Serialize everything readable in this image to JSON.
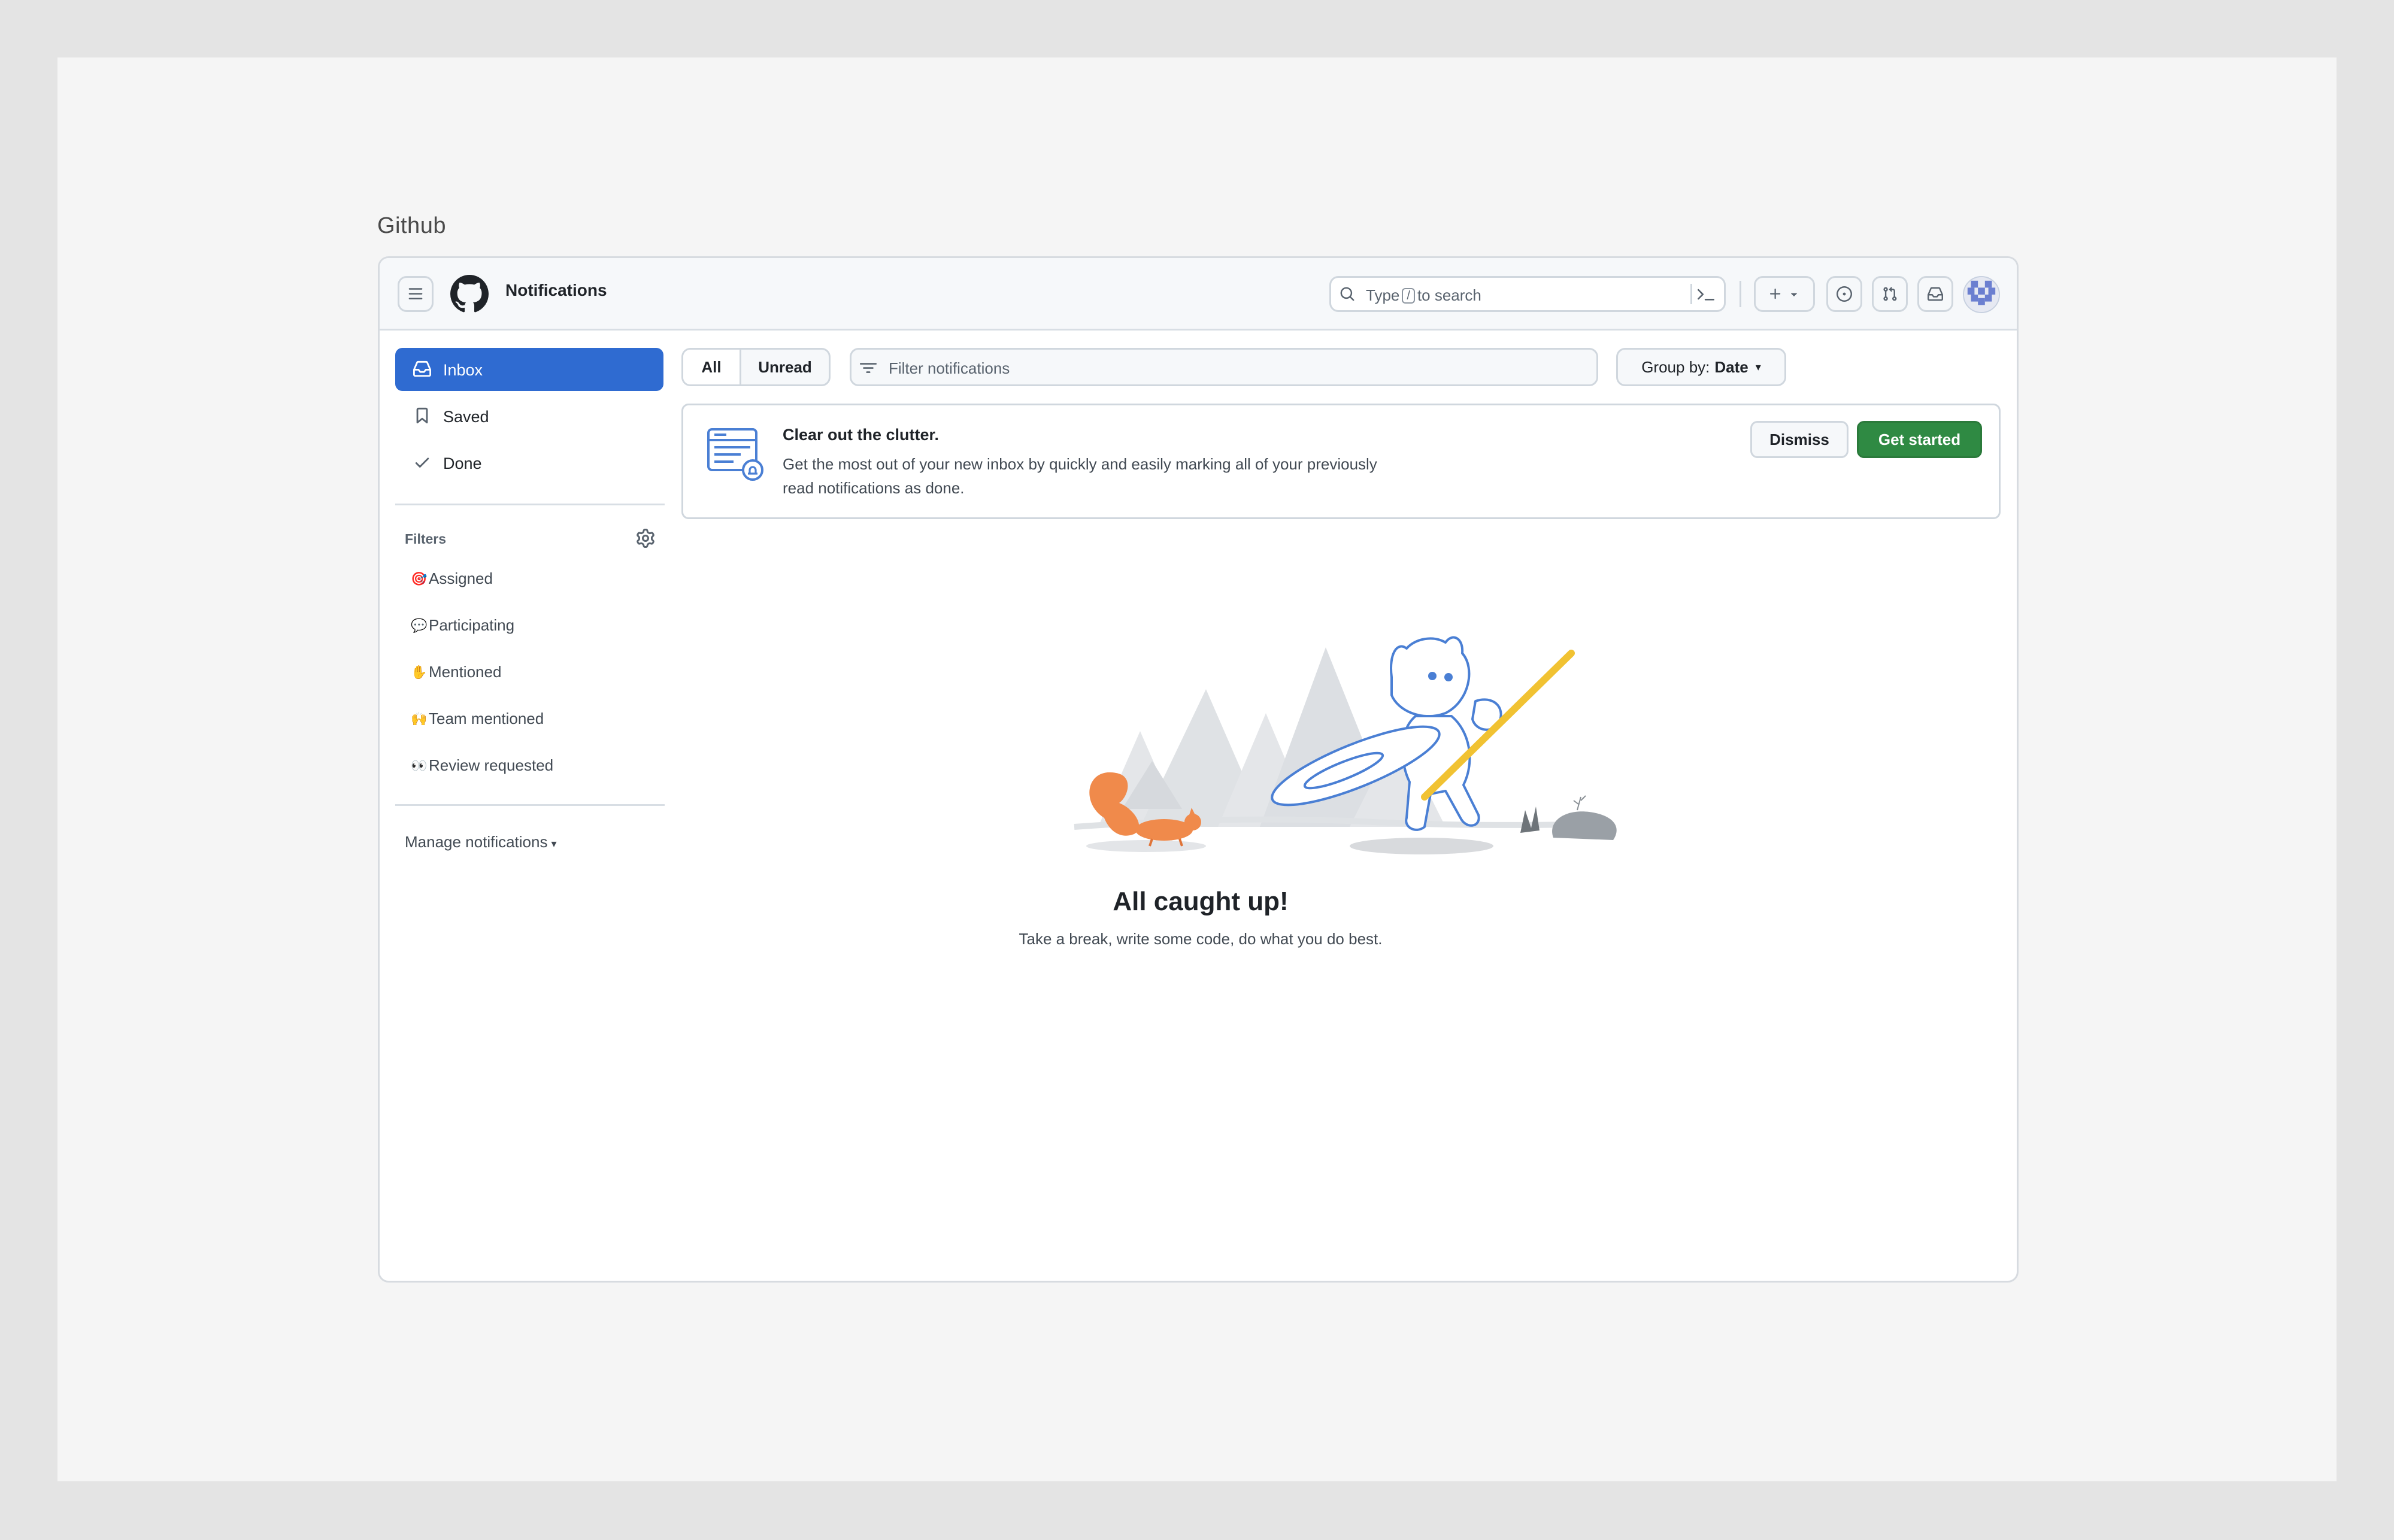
{
  "page_caption": "Github",
  "header": {
    "title": "Notifications",
    "search": {
      "prefix": "Type",
      "shortcut": "/",
      "suffix": "to search"
    }
  },
  "sidebar": {
    "nav": [
      {
        "label": "Inbox",
        "icon": "inbox-icon",
        "active": true
      },
      {
        "label": "Saved",
        "icon": "bookmark-icon",
        "active": false
      },
      {
        "label": "Done",
        "icon": "check-icon",
        "active": false
      }
    ],
    "filters_heading": "Filters",
    "filters": [
      {
        "emoji": "🎯",
        "label": "Assigned"
      },
      {
        "emoji": "💬",
        "label": "Participating"
      },
      {
        "emoji": "✋",
        "label": "Mentioned"
      },
      {
        "emoji": "🙌",
        "label": "Team mentioned"
      },
      {
        "emoji": "👀",
        "label": "Review requested"
      }
    ],
    "manage_label": "Manage notifications"
  },
  "toolbar": {
    "tab_all": "All",
    "tab_unread": "Unread",
    "filter_placeholder": "Filter notifications",
    "group_by_label": "Group by:",
    "group_by_value": "Date"
  },
  "banner": {
    "title": "Clear out the clutter.",
    "body": "Get the most out of your new inbox by quickly and easily marking all of your previously read notifications as done.",
    "dismiss_label": "Dismiss",
    "get_started_label": "Get started"
  },
  "empty_state": {
    "title": "All caught up!",
    "subtitle": "Take a break, write some code, do what you do best."
  },
  "colors": {
    "accent": "#2f6bd1",
    "primary_button": "#2f8a43",
    "border": "#d0d7de"
  }
}
